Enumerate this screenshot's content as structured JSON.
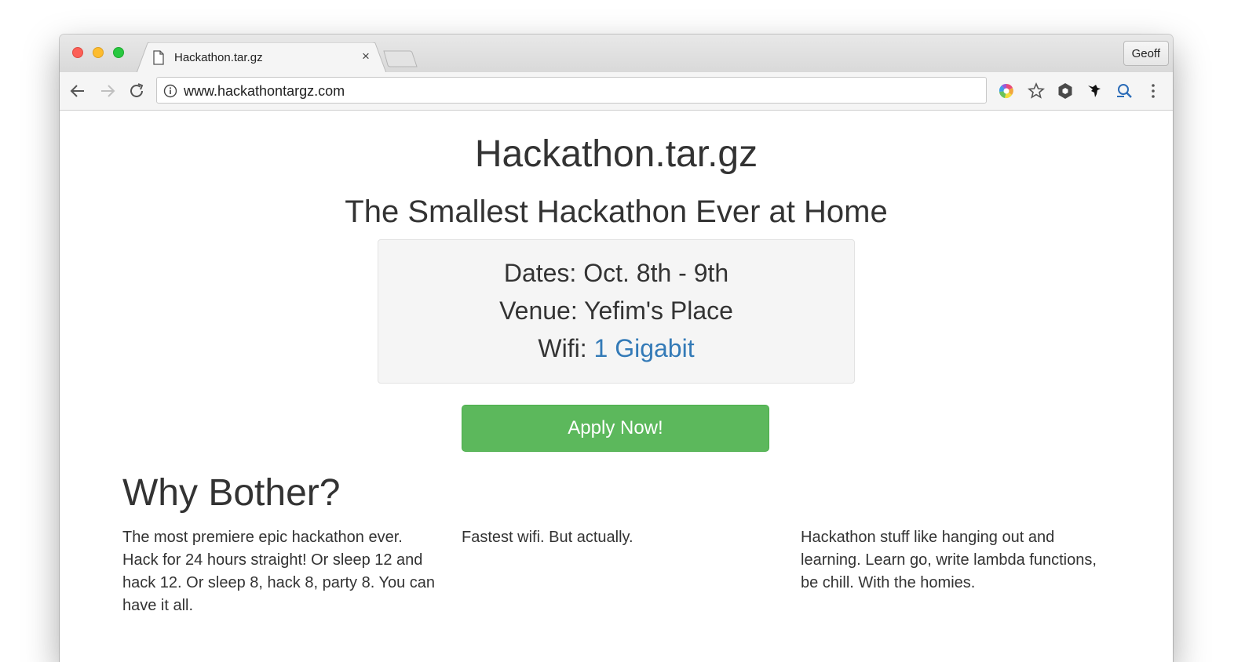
{
  "browser": {
    "tab": {
      "title": "Hackathon.tar.gz",
      "close_label": "×"
    },
    "profile_label": "Geoff",
    "url": "www.hackathontargz.com"
  },
  "page": {
    "title": "Hackathon.tar.gz",
    "subtitle": "The Smallest Hackathon Ever at Home",
    "info": {
      "dates_label": "Dates:",
      "dates_value": "Oct. 8th - 9th",
      "venue_label": "Venue:",
      "venue_value": "Yefim's Place",
      "wifi_label": "Wifi:",
      "wifi_value": "1 Gigabit"
    },
    "apply_button": "Apply Now!",
    "why_heading": "Why Bother?",
    "columns": [
      "The most premiere epic hackathon ever. Hack for 24 hours straight! Or sleep 12 and hack 12. Or sleep 8, hack 8, party 8. You can have it all.",
      "Fastest wifi. But actually.",
      "Hackathon stuff like hanging out and learning. Learn go, write lambda functions, be chill. With the homies."
    ]
  },
  "icons": {
    "nav": [
      "back-arrow-icon",
      "forward-arrow-icon",
      "reload-icon"
    ],
    "toolbar": [
      "color-wheel-extension-icon",
      "bookmark-star-icon",
      "hexagon-extension-icon",
      "bird-extension-icon",
      "search-extension-icon",
      "menu-kebab-icon"
    ]
  },
  "colors": {
    "link": "#337ab7",
    "button": "#5cb85c",
    "text": "#333333"
  }
}
